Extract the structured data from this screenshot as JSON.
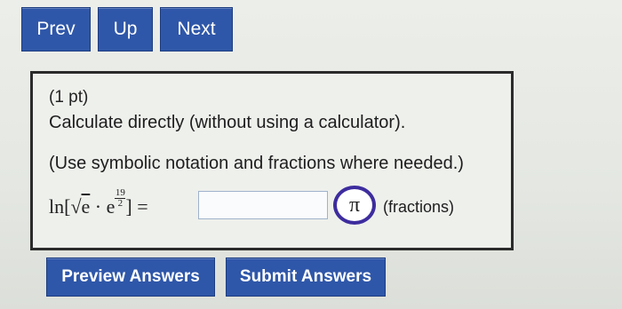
{
  "nav": {
    "prev": "Prev",
    "up": "Up",
    "next": "Next"
  },
  "problem": {
    "points": "(1 pt)",
    "question": "Calculate directly (without using a calculator).",
    "instruction": "(Use symbolic notation and fractions where needed.)",
    "expression": {
      "func": "ln",
      "base": "e",
      "exp_numerator": "19",
      "exp_denominator": "2",
      "equals": "="
    },
    "answer_value": "",
    "pi_symbol": "π",
    "fractions_note": "(fractions)"
  },
  "actions": {
    "preview": "Preview Answers",
    "submit": "Submit Answers"
  },
  "colors": {
    "button": "#2f57a9",
    "highlight_circle": "#3d2c9e"
  }
}
